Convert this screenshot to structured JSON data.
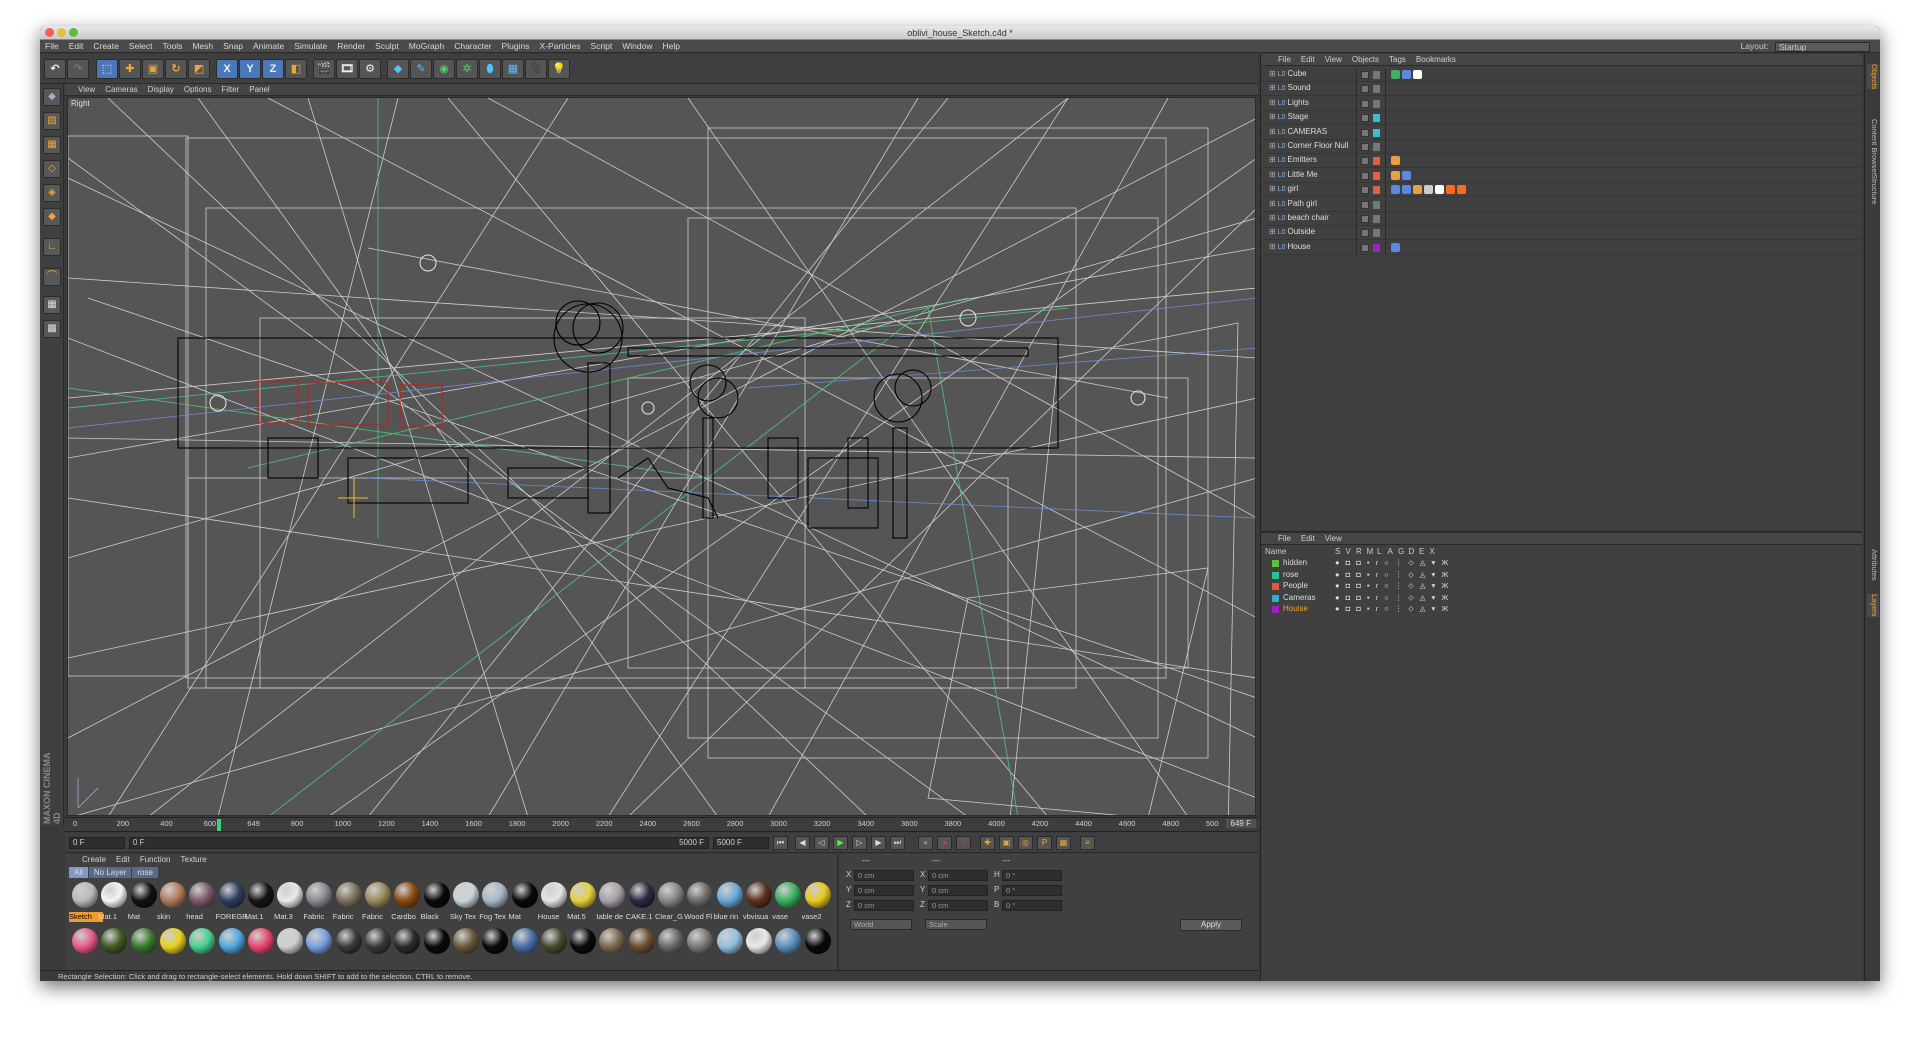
{
  "window": {
    "title": "oblivi_house_Sketch.c4d *"
  },
  "menubar": [
    "File",
    "Edit",
    "Create",
    "Select",
    "Tools",
    "Mesh",
    "Snap",
    "Animate",
    "Simulate",
    "Render",
    "Sculpt",
    "MoGraph",
    "Character",
    "Plugins",
    "X-Particles",
    "Script",
    "Window",
    "Help"
  ],
  "layout": {
    "label": "Layout:",
    "value": "Startup"
  },
  "toolbar": {
    "icons": [
      "undo-icon",
      "redo-icon",
      "select-icon",
      "move-icon",
      "scale-icon",
      "rotate-icon",
      "last-tool-icon",
      "x-axis-icon",
      "y-axis-icon",
      "z-axis-icon",
      "coord-system-icon",
      "render-view-icon",
      "render-picture-viewer-icon",
      "render-settings-icon",
      "cube-icon",
      "spline-pen-icon",
      "subdivision-icon",
      "array-icon",
      "deformer-icon",
      "floor-icon",
      "camera-icon",
      "light-icon"
    ],
    "axis": [
      "X",
      "Y",
      "Z"
    ]
  },
  "viewport": {
    "menu": [
      "View",
      "Cameras",
      "Display",
      "Options",
      "Filter",
      "Panel"
    ],
    "label": "Right"
  },
  "timeline": {
    "ticks": [
      "0",
      "200",
      "400",
      "600",
      "649",
      "800",
      "1000",
      "1200",
      "1400",
      "1600",
      "1800",
      "2000",
      "2200",
      "2400",
      "2600",
      "2800",
      "3000",
      "3200",
      "3400",
      "3600",
      "3800",
      "4000",
      "4200",
      "4400",
      "4600",
      "4800",
      "500"
    ],
    "current": "649 F"
  },
  "transport": {
    "start": "0 F",
    "range_start": "0 F",
    "range_end": "5000 F",
    "end": "5000 F"
  },
  "materials": {
    "menu": [
      "Create",
      "Edit",
      "Function",
      "Texture"
    ],
    "tabs": [
      "All",
      "No Layer",
      "rose"
    ],
    "row1": [
      {
        "name": "Sketch",
        "color": "#b9b9b9",
        "selected": true
      },
      {
        "name": "Mat.1",
        "color": "#f4f4f4"
      },
      {
        "name": "Mat",
        "color": "#111111"
      },
      {
        "name": "skin",
        "color": "#b07a5a"
      },
      {
        "name": "head",
        "color": "#7a5a6a"
      },
      {
        "name": "FOREGR",
        "color": "#2d4060"
      },
      {
        "name": "Mat.1",
        "color": "#151515"
      },
      {
        "name": "Mat.3",
        "color": "#e8e8e8"
      },
      {
        "name": "Fabric",
        "color": "#8a8a94"
      },
      {
        "name": "Fabric",
        "color": "#7a705a"
      },
      {
        "name": "Fabric",
        "color": "#9a8a5a"
      },
      {
        "name": "Cardbo",
        "color": "#8a4a10"
      },
      {
        "name": "Black",
        "color": "#0a0a0a"
      },
      {
        "name": "Sky Tex",
        "color": "#c8d4dc"
      },
      {
        "name": "Fog Tex",
        "color": "#a8b8c8"
      },
      {
        "name": "Mat",
        "color": "#0a0a0a"
      },
      {
        "name": "House",
        "color": "#e4e4e4"
      },
      {
        "name": "Mat.5",
        "color": "#e8d040"
      },
      {
        "name": "table de",
        "color": "#a8a0a8"
      },
      {
        "name": "CAKE.1",
        "color": "#2a2a40"
      },
      {
        "name": "Clear_G",
        "color": "#888888"
      },
      {
        "name": "Wood Fl",
        "color": "#6a6a6a"
      },
      {
        "name": "blue rin",
        "color": "#6aa8d8"
      },
      {
        "name": "vbvisua",
        "color": "#5a3020"
      },
      {
        "name": "vase",
        "color": "#38b060"
      },
      {
        "name": "vase2",
        "color": "#e8c820"
      }
    ],
    "row2": [
      "#e85a88",
      "#405a20",
      "#3a7a30",
      "#e8d020",
      "#48d090",
      "#50a8e0",
      "#e84870",
      "#cfcfcf",
      "#7aa0e0",
      "#3a3a3a",
      "#3a3a3a",
      "#2a2a2a",
      "#0a0a0a",
      "#6a5a3a",
      "#0a0a0a",
      "#4a70a8",
      "#4a4a30",
      "#0a0a0a",
      "#7a6a50",
      "#6a5030",
      "#6a6a6a",
      "#7a7a7a",
      "#90c0e0",
      "#e8e8e8",
      "#5a90c0",
      "#0a0a0a"
    ]
  },
  "attributes": {
    "headers": [
      "---",
      "---",
      "---"
    ],
    "rows": [
      {
        "a": "X",
        "av": "0 cm",
        "b": "X",
        "bv": "0 cm",
        "c": "H",
        "cv": "0 °"
      },
      {
        "a": "Y",
        "av": "0 cm",
        "b": "Y",
        "bv": "0 cm",
        "c": "P",
        "cv": "0 °"
      },
      {
        "a": "Z",
        "av": "0 cm",
        "b": "Z",
        "bv": "0 cm",
        "c": "B",
        "cv": "0 °"
      }
    ],
    "world": "World",
    "scale": "Scale",
    "apply": "Apply"
  },
  "status": "Rectangle Selection: Click and drag to rectangle-select elements. Hold down SHIFT to add to the selection, CTRL to remove.",
  "objects": {
    "menu": [
      "File",
      "Edit",
      "View",
      "Objects",
      "Tags",
      "Bookmarks"
    ],
    "items": [
      {
        "name": "Cube",
        "color": "#777777",
        "tags": [
          "#3fb060",
          "#5a8ae0",
          "#ffffff"
        ]
      },
      {
        "name": "Sound",
        "color": "#777777",
        "tags": []
      },
      {
        "name": "Lights",
        "color": "#777777",
        "tags": []
      },
      {
        "name": "Stage",
        "color": "#3ac0c8",
        "tags": []
      },
      {
        "name": "CAMERAS",
        "color": "#3ac0c8",
        "tags": []
      },
      {
        "name": "Corner Floor Null",
        "color": "#777777",
        "tags": []
      },
      {
        "name": "Emitters",
        "color": "#e06040",
        "tags": [
          "#e8a040"
        ]
      },
      {
        "name": "Little Me",
        "color": "#e06040",
        "tags": [
          "#e8a040",
          "#5a8ae0"
        ]
      },
      {
        "name": "girl",
        "color": "#e06040",
        "tags": [
          "#5a8ae0",
          "#5a8ae0",
          "#e8a040",
          "#cccccc",
          "#ffffff",
          "#ff6a20",
          "#ff6a20"
        ]
      },
      {
        "name": "Path girl",
        "color": "#777777",
        "tags": []
      },
      {
        "name": "beach chair",
        "color": "#777777",
        "tags": []
      },
      {
        "name": "Outside",
        "color": "#777777",
        "tags": []
      },
      {
        "name": "House",
        "color": "#a020c0",
        "tags": [
          "#5a8ae0"
        ]
      }
    ]
  },
  "layers": {
    "menu": [
      "File",
      "Edit",
      "View"
    ],
    "header": [
      "Name",
      "S",
      "V",
      "R",
      "M",
      "L",
      "A",
      "G",
      "D",
      "E",
      "X"
    ],
    "items": [
      {
        "name": "hidden",
        "color": "#60c040"
      },
      {
        "name": "rose",
        "color": "#30c090"
      },
      {
        "name": "People",
        "color": "#e05a40"
      },
      {
        "name": "Cameras",
        "color": "#30b0c0"
      },
      {
        "name": "Houise",
        "color": "#a020c0",
        "active": true
      }
    ]
  },
  "side_tabs": {
    "top": [
      "Objects",
      "Content Browser",
      "Structure"
    ],
    "bottom": [
      "Attributes",
      "Layers"
    ]
  }
}
